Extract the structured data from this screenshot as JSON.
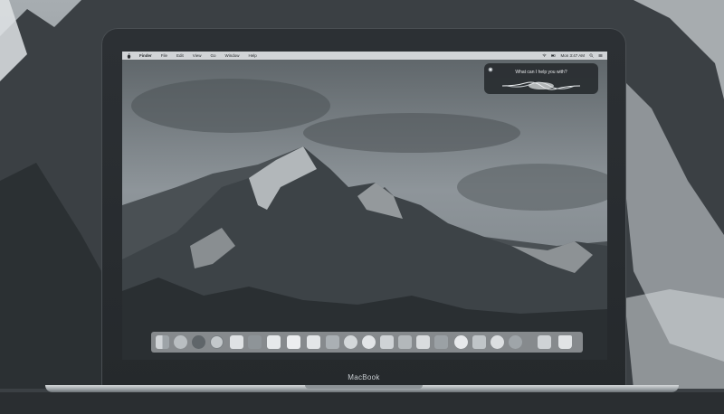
{
  "menubar": {
    "items": [
      "Finder",
      "File",
      "Edit",
      "View",
      "Go",
      "Window",
      "Help"
    ],
    "clock": "Mon 3:47 AM"
  },
  "siri": {
    "prompt": "What can I help you with?"
  },
  "laptop": {
    "brand": "MacBook"
  },
  "dock": {
    "icons": [
      "finder-icon",
      "launchpad-icon",
      "siri-icon",
      "safari-icon",
      "mail-icon",
      "contacts-icon",
      "calendar-icon",
      "notes-icon",
      "reminders-icon",
      "maps-icon",
      "photos-icon",
      "messages-icon",
      "facetime-icon",
      "pages-icon",
      "numbers-icon",
      "keynote-icon",
      "itunes-icon",
      "ibooks-icon",
      "app-store-icon",
      "system-preferences-icon",
      "downloads-folder-icon",
      "trash-icon"
    ]
  },
  "colors": {
    "sky": "#8a9196",
    "rock": "#3a3f43",
    "snow": "#e9ecee",
    "bezel": "#2a2e31"
  }
}
